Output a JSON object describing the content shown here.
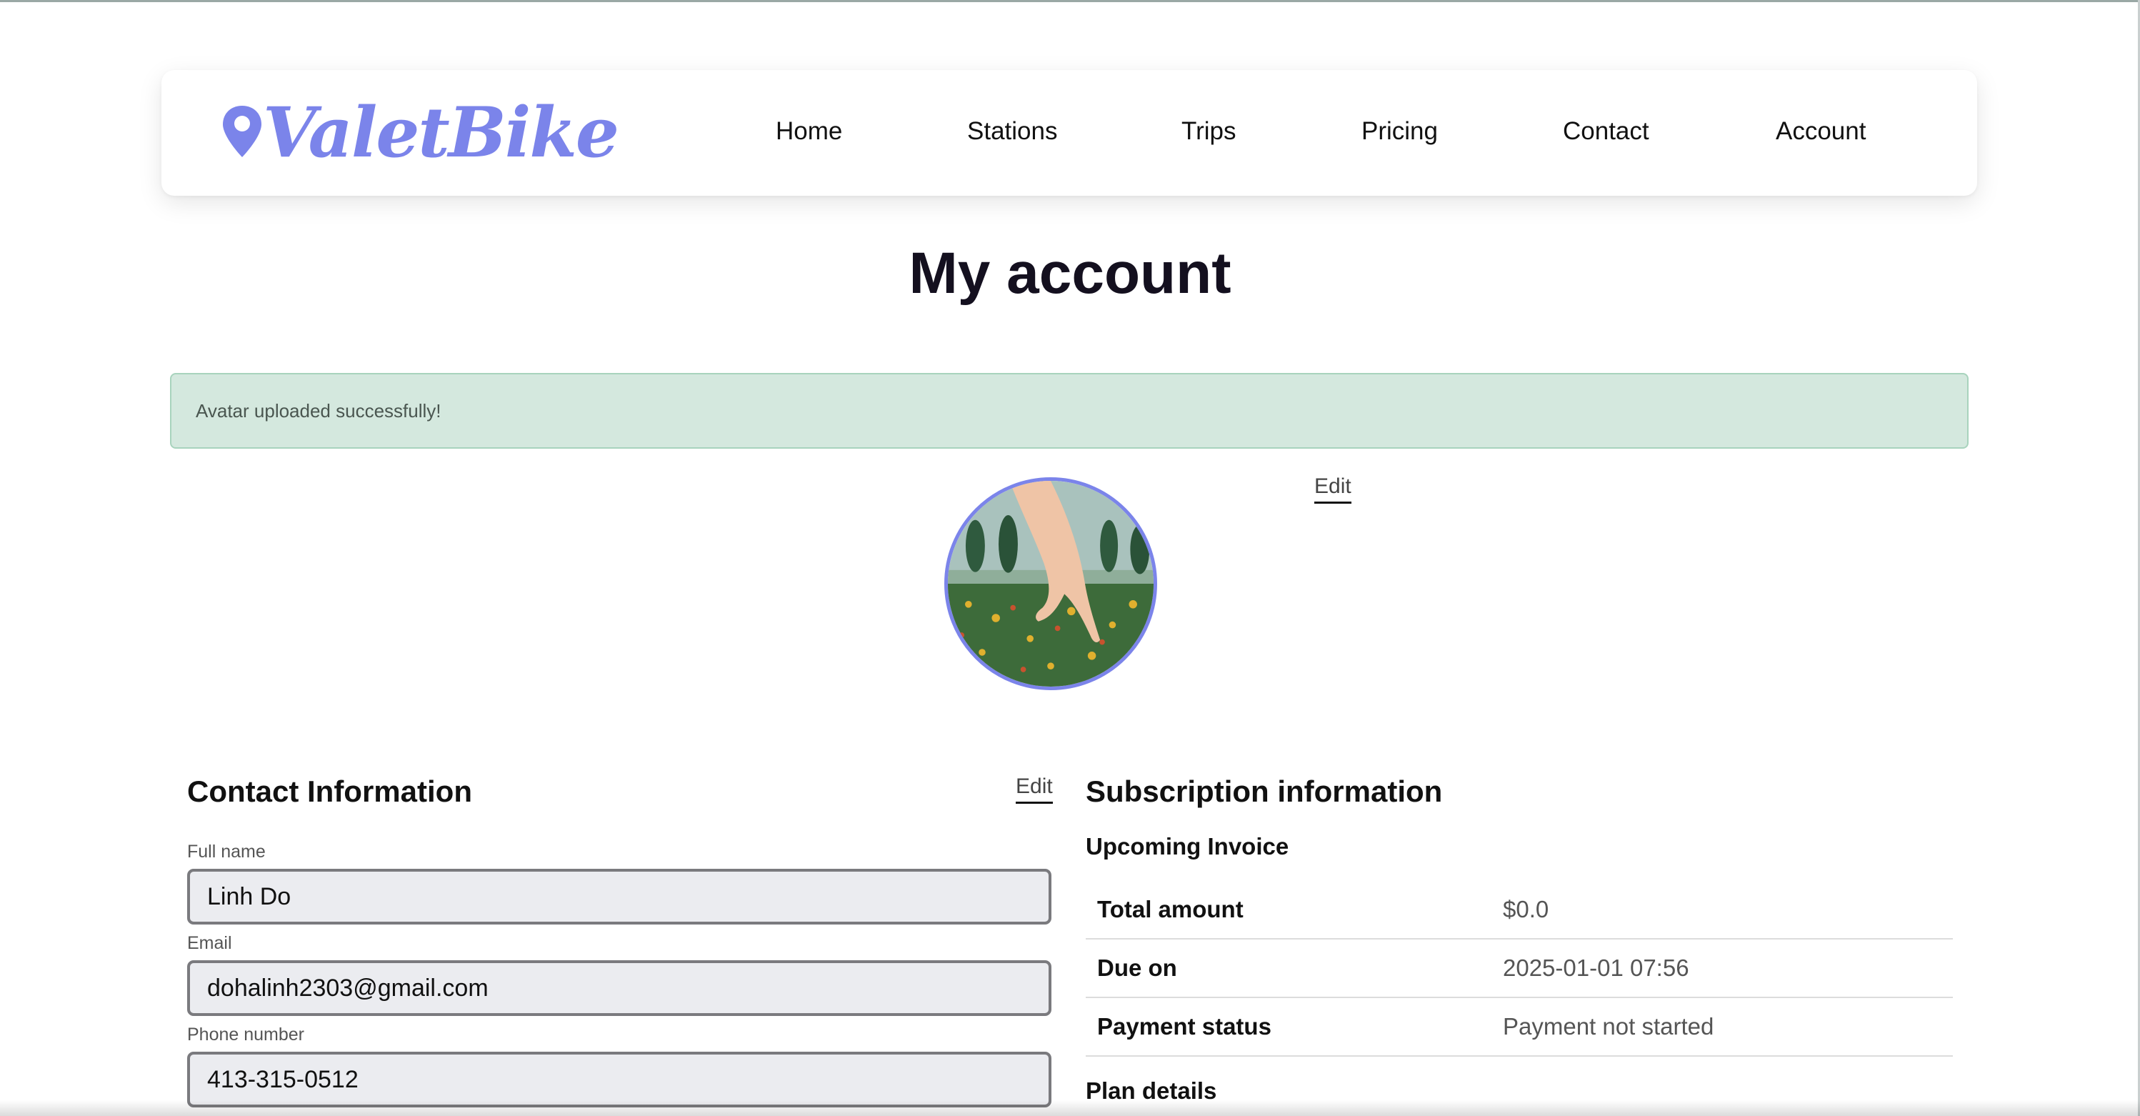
{
  "brand": {
    "name": "ValetBike",
    "color": "#7b84ea",
    "icon": "map-pin-icon"
  },
  "nav": {
    "items": [
      {
        "label": "Home"
      },
      {
        "label": "Stations"
      },
      {
        "label": "Trips"
      },
      {
        "label": "Pricing"
      },
      {
        "label": "Contact"
      },
      {
        "label": "Account"
      }
    ]
  },
  "page": {
    "title": "My account"
  },
  "alert": {
    "message": "Avatar uploaded successfully!",
    "background": "#d4e8de"
  },
  "avatar": {
    "edit_label": "Edit",
    "border_color": "#7b84ea"
  },
  "contact": {
    "title": "Contact Information",
    "edit_label": "Edit",
    "full_name_label": "Full name",
    "full_name": "Linh Do",
    "email_label": "Email",
    "email": "dohalinh2303@gmail.com",
    "phone_label": "Phone number",
    "phone": "413-315-0512"
  },
  "subscription": {
    "title": "Subscription information",
    "upcoming_invoice_label": "Upcoming Invoice",
    "rows": [
      {
        "key": "Total amount",
        "value": "$0.0"
      },
      {
        "key": "Due on",
        "value": "2025-01-01 07:56"
      },
      {
        "key": "Payment status",
        "value": "Payment not started"
      }
    ],
    "plan_details_label": "Plan details"
  }
}
